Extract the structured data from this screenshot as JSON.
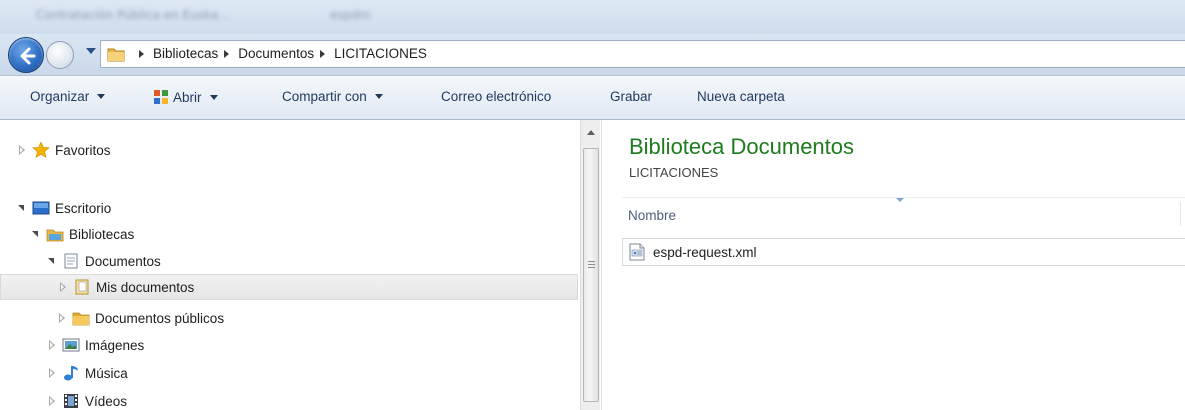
{
  "browser_tabs": [
    {
      "label": "Contratación Pública en Euska..."
    },
    {
      "label": "espdm"
    }
  ],
  "address": {
    "crumbs": [
      "Bibliotecas",
      "Documentos",
      "LICITACIONES"
    ]
  },
  "toolbar": {
    "organize": "Organizar",
    "open": "Abrir",
    "share": "Compartir con",
    "email": "Correo electrónico",
    "burn": "Grabar",
    "new_folder": "Nueva carpeta"
  },
  "tree": {
    "favorites": "Favoritos",
    "desktop": "Escritorio",
    "libraries": "Bibliotecas",
    "documents": "Documentos",
    "my_documents": "Mis documentos",
    "public_documents": "Documentos públicos",
    "images": "Imágenes",
    "music": "Música",
    "videos": "Vídeos"
  },
  "content": {
    "title": "Biblioteca Documentos",
    "subtitle": "LICITACIONES",
    "column_name": "Nombre",
    "files": [
      {
        "name": "espd-request.xml",
        "icon": "xml-file-icon"
      }
    ]
  },
  "colors": {
    "title_green": "#1e7b1e",
    "command_text": "#1e395b",
    "selection_bg": "#e6e6e6"
  }
}
